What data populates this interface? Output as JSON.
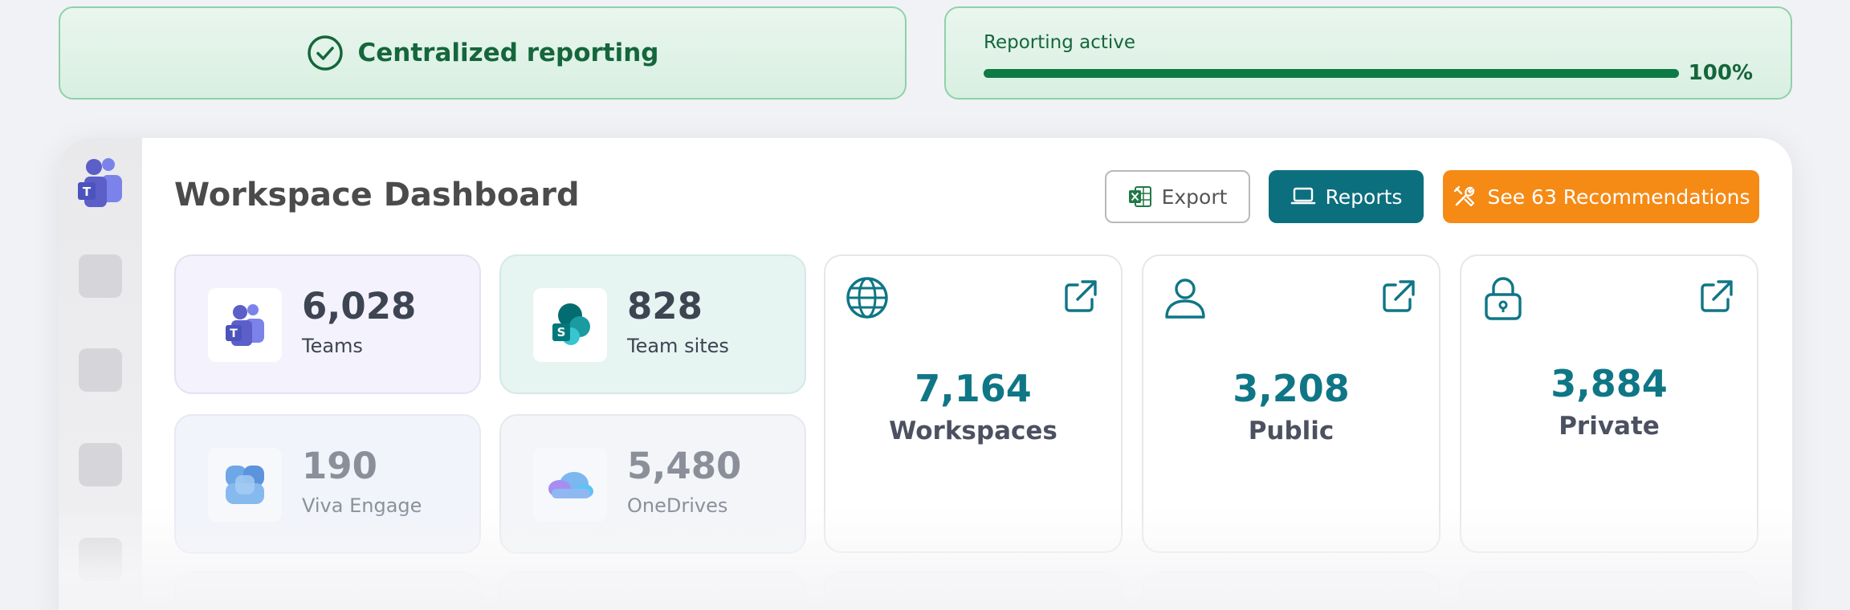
{
  "banners": {
    "centralized": {
      "title": "Centralized reporting",
      "icon": "check-circle-icon",
      "color": "#15663b"
    },
    "reporting": {
      "label": "Reporting active",
      "progress": 1.0,
      "percent_text": "100%"
    }
  },
  "dashboard": {
    "title": "Workspace Dashboard",
    "buttons": {
      "export": "Export",
      "reports": "Reports",
      "recommendations": "See 63 Recommendations"
    },
    "stats": [
      {
        "value": "6,028",
        "label": "Teams",
        "icon": "teams-icon"
      },
      {
        "value": "828",
        "label": "Team sites",
        "icon": "sharepoint-icon"
      },
      {
        "value": "190",
        "label": "Viva Engage",
        "icon": "viva-engage-icon"
      },
      {
        "value": "5,480",
        "label": "OneDrives",
        "icon": "onedrive-icon"
      }
    ],
    "workspace_cards": [
      {
        "value": "7,164",
        "label": "Workspaces",
        "icon": "globe-icon"
      },
      {
        "value": "3,208",
        "label": "Public",
        "icon": "user-icon"
      },
      {
        "value": "3,884",
        "label": "Private",
        "icon": "lock-icon"
      }
    ],
    "colors": {
      "teal": "#0c6f7e",
      "orange": "#f58a15",
      "green": "#15663b"
    }
  }
}
